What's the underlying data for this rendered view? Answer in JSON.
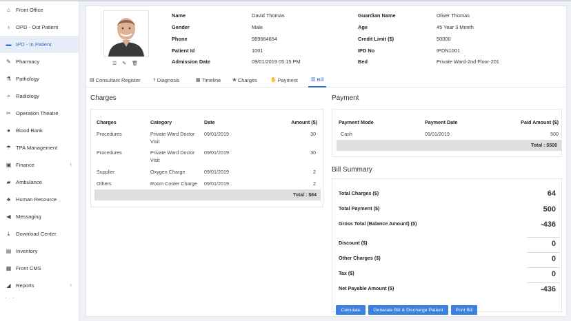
{
  "sidebar": {
    "items": [
      {
        "label": "Front Office",
        "icon": "building-icon",
        "glyph": "⌂"
      },
      {
        "label": "OPD - Out Patient",
        "icon": "stethoscope-icon",
        "glyph": "♁"
      },
      {
        "label": "IPD - In Patient",
        "icon": "bed-icon",
        "glyph": "▬",
        "active": true
      },
      {
        "label": "Pharmacy",
        "icon": "pills-icon",
        "glyph": "✎"
      },
      {
        "label": "Pathology",
        "icon": "flask-icon",
        "glyph": "⚗"
      },
      {
        "label": "Radiology",
        "icon": "microscope-icon",
        "glyph": "⌕"
      },
      {
        "label": "Operation Theatre",
        "icon": "scissors-icon",
        "glyph": "✂"
      },
      {
        "label": "Blood Bank",
        "icon": "droplet-icon",
        "glyph": "●"
      },
      {
        "label": "TPA Management",
        "icon": "umbrella-icon",
        "glyph": "☂"
      },
      {
        "label": "Finance",
        "icon": "money-icon",
        "glyph": "▣",
        "chevron": "‹"
      },
      {
        "label": "Ambulance",
        "icon": "ambulance-icon",
        "glyph": "▰"
      },
      {
        "label": "Human Resource",
        "icon": "sitemap-icon",
        "glyph": "♣"
      },
      {
        "label": "Messaging",
        "icon": "bullhorn-icon",
        "glyph": "◀"
      },
      {
        "label": "Download Center",
        "icon": "download-icon",
        "glyph": "⤓"
      },
      {
        "label": "Inventory",
        "icon": "inventory-icon",
        "glyph": "▤"
      },
      {
        "label": "Front CMS",
        "icon": "cms-icon",
        "glyph": "▦"
      },
      {
        "label": "Reports",
        "icon": "chart-icon",
        "glyph": "◢",
        "chevron": "‹"
      }
    ]
  },
  "patient": {
    "rows": [
      {
        "l1": "Name",
        "v1": "David Thomas",
        "l2": "Guardian Name",
        "v2": "Oliver Thomas"
      },
      {
        "l1": "Gender",
        "v1": "Male",
        "l2": "Age",
        "v2": "45 Year 3 Month"
      },
      {
        "l1": "Phone",
        "v1": "989664654",
        "l2": "Credit Limit ($)",
        "v2": "50000"
      },
      {
        "l1": "Patient Id",
        "v1": "1001",
        "l2": "IPD No",
        "v2": "IPDN1001"
      },
      {
        "l1": "Admission Date",
        "v1": "09/01/2019 05:15 PM",
        "l2": "Bed",
        "v2": "Private Ward-2nd Floor-201"
      }
    ]
  },
  "tabs": [
    {
      "label": "Consultant Register",
      "icon": "document-icon",
      "glyph": "▤"
    },
    {
      "label": "Diagnosis",
      "icon": "diagnosis-icon",
      "glyph": "⚕"
    },
    {
      "label": "Timeline",
      "icon": "calendar-icon",
      "glyph": "▦"
    },
    {
      "label": "Charges",
      "icon": "charges-icon",
      "glyph": "❀"
    },
    {
      "label": "Payment",
      "icon": "payment-icon",
      "glyph": "✋"
    },
    {
      "label": "Bill",
      "icon": "bill-icon",
      "glyph": "▥",
      "active": true
    }
  ],
  "charges": {
    "title": "Charges",
    "headers": [
      "Charges",
      "Category",
      "Date",
      "Amount ($)"
    ],
    "rows": [
      {
        "charge": "Procedures",
        "category": "Private Ward Doctor Visit",
        "date": "09/01/2019",
        "amount": "30"
      },
      {
        "charge": "Procedures",
        "category": "Private Ward Doctor Visit",
        "date": "09/01/2019",
        "amount": "30"
      },
      {
        "charge": "Supplier",
        "category": "Oxygen Charge",
        "date": "09/01/2019",
        "amount": "2"
      },
      {
        "charge": "Others",
        "category": "Room Cooler Charge",
        "date": "09/01/2019",
        "amount": "2"
      }
    ],
    "total": "Total : $64"
  },
  "payment": {
    "title": "Payment",
    "headers": [
      "Payment Mode",
      "Payment Date",
      "Paid Amount ($)"
    ],
    "rows": [
      {
        "mode": "Cash",
        "date": "09/01/2019",
        "amount": "500"
      }
    ],
    "total": "Total : $500"
  },
  "summary": {
    "title": "Bill Summary",
    "items": [
      {
        "label": "Total Charges ($)",
        "value": "64"
      },
      {
        "label": "Total Payment ($)",
        "value": "500"
      },
      {
        "label": "Gross Total (Balance Amount) ($)",
        "value": "-436"
      },
      {
        "label": "Discount ($)",
        "value": "0"
      },
      {
        "label": "Other Charges ($)",
        "value": "0"
      },
      {
        "label": "Tax ($)",
        "value": "0"
      },
      {
        "label": "Net Payable Amount ($)",
        "value": "-436"
      }
    ]
  },
  "actions": {
    "calculate": "Calculate",
    "generate": "Generate Bill & Discharge Patient",
    "print": "Print Bill"
  },
  "colors": {
    "accent": "#3b82e0",
    "active_bg": "#e6edf7"
  }
}
